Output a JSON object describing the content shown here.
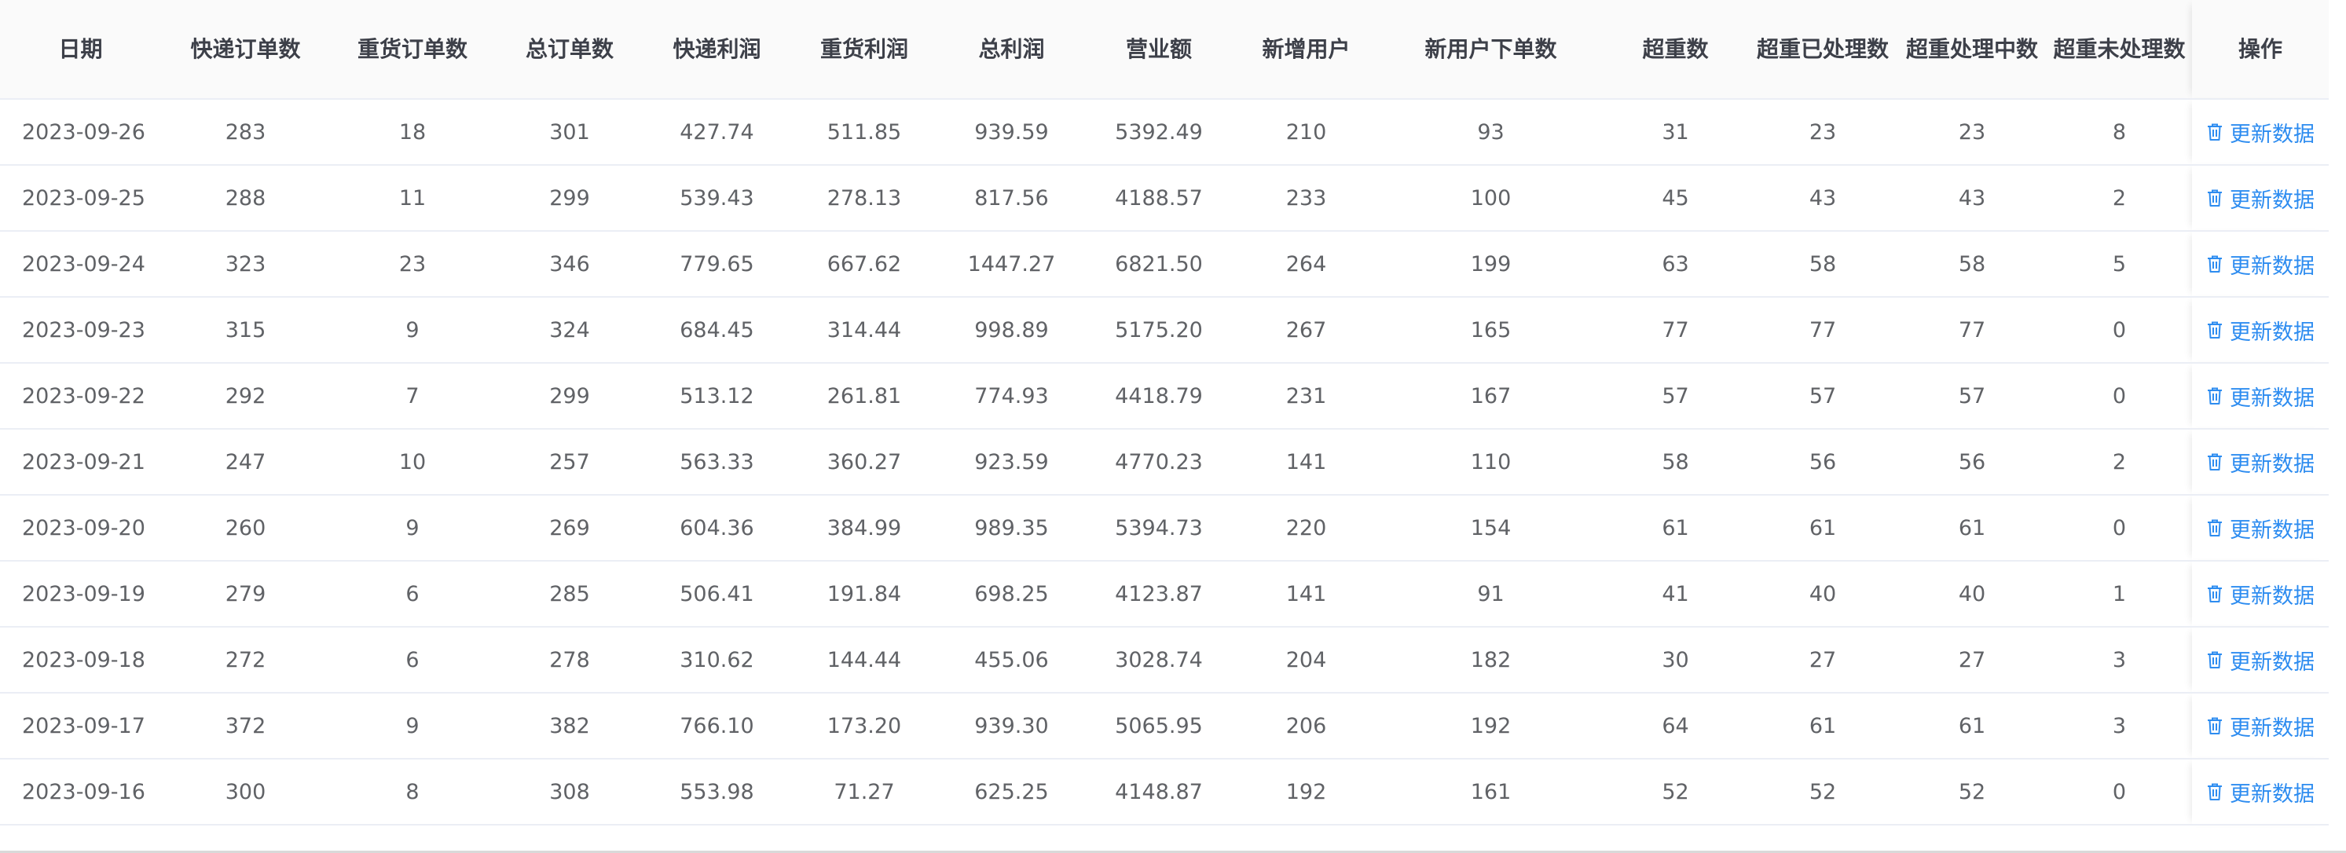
{
  "table": {
    "columns": [
      "日期",
      "快递订单数",
      "重货订单数",
      "总订单数",
      "快递利润",
      "重货利润",
      "总利润",
      "营业额",
      "新增用户",
      "新用户下单数",
      "超重数",
      "超重已处理数",
      "超重处理中数",
      "超重未处理数",
      "操作"
    ],
    "action_label": "更新数据",
    "action_icon": "trash-icon",
    "rows": [
      [
        "2023-09-26",
        "283",
        "18",
        "301",
        "427.74",
        "511.85",
        "939.59",
        "5392.49",
        "210",
        "93",
        "31",
        "23",
        "23",
        "8"
      ],
      [
        "2023-09-25",
        "288",
        "11",
        "299",
        "539.43",
        "278.13",
        "817.56",
        "4188.57",
        "233",
        "100",
        "45",
        "43",
        "43",
        "2"
      ],
      [
        "2023-09-24",
        "323",
        "23",
        "346",
        "779.65",
        "667.62",
        "1447.27",
        "6821.50",
        "264",
        "199",
        "63",
        "58",
        "58",
        "5"
      ],
      [
        "2023-09-23",
        "315",
        "9",
        "324",
        "684.45",
        "314.44",
        "998.89",
        "5175.20",
        "267",
        "165",
        "77",
        "77",
        "77",
        "0"
      ],
      [
        "2023-09-22",
        "292",
        "7",
        "299",
        "513.12",
        "261.81",
        "774.93",
        "4418.79",
        "231",
        "167",
        "57",
        "57",
        "57",
        "0"
      ],
      [
        "2023-09-21",
        "247",
        "10",
        "257",
        "563.33",
        "360.27",
        "923.59",
        "4770.23",
        "141",
        "110",
        "58",
        "56",
        "56",
        "2"
      ],
      [
        "2023-09-20",
        "260",
        "9",
        "269",
        "604.36",
        "384.99",
        "989.35",
        "5394.73",
        "220",
        "154",
        "61",
        "61",
        "61",
        "0"
      ],
      [
        "2023-09-19",
        "279",
        "6",
        "285",
        "506.41",
        "191.84",
        "698.25",
        "4123.87",
        "141",
        "91",
        "41",
        "40",
        "40",
        "1"
      ],
      [
        "2023-09-18",
        "272",
        "6",
        "278",
        "310.62",
        "144.44",
        "455.06",
        "3028.74",
        "204",
        "182",
        "30",
        "27",
        "27",
        "3"
      ],
      [
        "2023-09-17",
        "372",
        "9",
        "382",
        "766.10",
        "173.20",
        "939.30",
        "5065.95",
        "206",
        "192",
        "64",
        "61",
        "61",
        "3"
      ],
      [
        "2023-09-16",
        "300",
        "8",
        "308",
        "553.98",
        "71.27",
        "625.25",
        "4148.87",
        "192",
        "161",
        "52",
        "52",
        "52",
        "0"
      ]
    ]
  },
  "colors": {
    "link": "#2d8cf0",
    "header_bg": "#fafafa",
    "border": "#ebeef5"
  }
}
